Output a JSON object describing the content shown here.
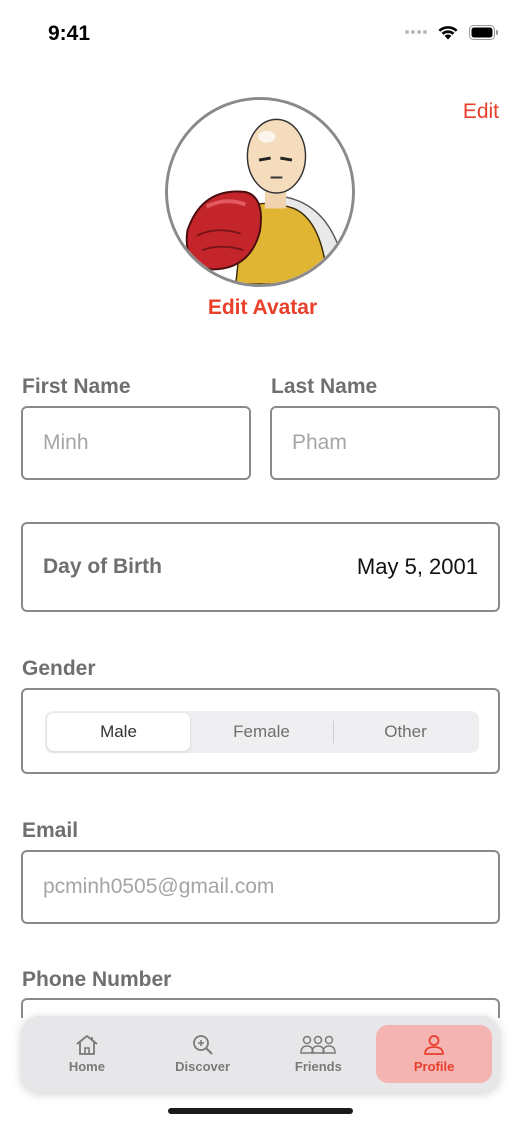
{
  "status_bar": {
    "time": "9:41",
    "icons": [
      "signal-icon",
      "wifi-icon",
      "battery-icon"
    ]
  },
  "header": {
    "edit_label": "Edit"
  },
  "avatar": {
    "image": "avatar-image",
    "edit_label": "Edit Avatar"
  },
  "form": {
    "first_name": {
      "label": "First Name",
      "placeholder": "Minh"
    },
    "last_name": {
      "label": "Last Name",
      "placeholder": "Pham"
    },
    "dob": {
      "label": "Day of Birth",
      "value": "May 5, 2001"
    },
    "gender": {
      "label": "Gender",
      "options": [
        "Male",
        "Female",
        "Other"
      ],
      "selected": "Male"
    },
    "email": {
      "label": "Email",
      "placeholder": "pcminh0505@gmail.com"
    },
    "phone": {
      "label": "Phone Number"
    }
  },
  "tab_bar": {
    "tabs": [
      {
        "label": "Home",
        "icon": "home-icon"
      },
      {
        "label": "Discover",
        "icon": "discover-icon"
      },
      {
        "label": "Friends",
        "icon": "friends-icon"
      },
      {
        "label": "Profile",
        "icon": "profile-icon"
      }
    ],
    "active": "Profile"
  },
  "colors": {
    "accent": "#e8402b",
    "active_tab_bg": "#f3b4b2",
    "border": "#8a8a8a",
    "label": "#6f6f6f"
  }
}
